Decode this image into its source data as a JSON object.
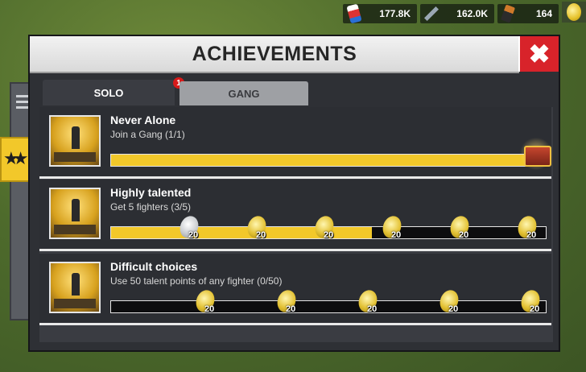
{
  "resources": [
    {
      "icon": "soda-can-icon",
      "value": "177.8K"
    },
    {
      "icon": "bolt-icon",
      "value": "162.0K"
    },
    {
      "icon": "battery-icon",
      "value": "164"
    }
  ],
  "dialog": {
    "title": "ACHIEVEMENTS",
    "close_icon": "close-icon",
    "tabs": [
      {
        "label": "SOLO",
        "badge": "1",
        "active": true
      },
      {
        "label": "GANG",
        "active": false
      }
    ]
  },
  "achievements": [
    {
      "name": "Never Alone",
      "description": "Join a Gang (1/1)",
      "progress": 1.0,
      "rewards": [],
      "chest": true
    },
    {
      "name": "Highly talented",
      "description": "Get 5 fighters (3/5)",
      "progress": 0.6,
      "rewards": [
        {
          "amount": "20",
          "claimed": true
        },
        {
          "amount": "20",
          "claimed": false
        },
        {
          "amount": "20",
          "claimed": false
        },
        {
          "amount": "20",
          "claimed": false
        },
        {
          "amount": "20",
          "claimed": false
        },
        {
          "amount": "20",
          "claimed": false
        }
      ]
    },
    {
      "name": "Difficult choices",
      "description": "Use 50 talent points of any fighter (0/50)",
      "progress": 0.0,
      "rewards": [
        {
          "amount": "20",
          "claimed": false
        },
        {
          "amount": "20",
          "claimed": false
        },
        {
          "amount": "20",
          "claimed": false
        },
        {
          "amount": "20",
          "claimed": false
        },
        {
          "amount": "20",
          "claimed": false
        }
      ]
    }
  ],
  "colors": {
    "accent": "#f2c82a",
    "close": "#d8232a",
    "panel": "#2c2e33"
  }
}
